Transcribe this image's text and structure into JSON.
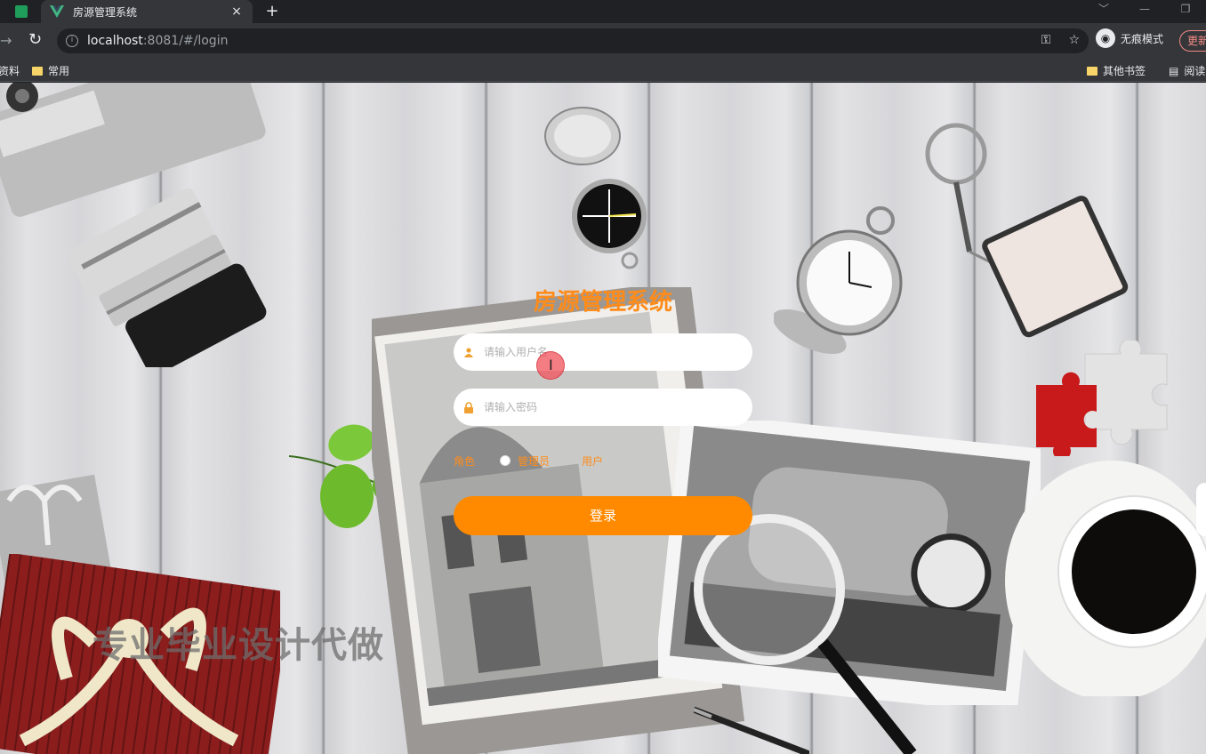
{
  "browser": {
    "tab_title": "房源管理系统",
    "new_tab_symbol": "+",
    "close_symbol": "×",
    "url_host": "localhost",
    "url_rest": ":8081/#/login",
    "incognito_label": "无痕模式",
    "update_label": "更新",
    "bookmarks": {
      "left_partial": "资料",
      "common": "常用",
      "other": "其他书签",
      "reading": "阅读"
    }
  },
  "login": {
    "title": "房源管理系统",
    "username_placeholder": "请输入用户名",
    "password_placeholder": "请输入密码",
    "roles": [
      "角色",
      "管理员",
      "用户"
    ],
    "submit_label": "登录"
  },
  "watermark": "专业毕业设计代做",
  "colors": {
    "accent": "#ff8a00",
    "title": "#ff8c1a"
  }
}
